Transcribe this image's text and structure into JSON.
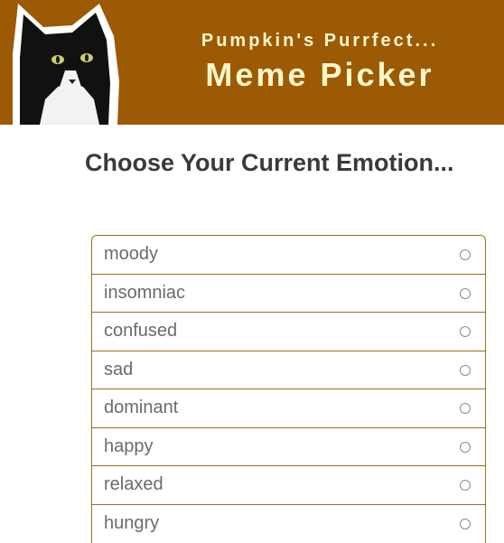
{
  "banner": {
    "subtitle": "Pumpkin's Purrfect...",
    "title": "Meme Picker",
    "background_color": "#9c5a05",
    "text_color": "#fff6c8",
    "logo_icon": "black-and-white-cat-photo"
  },
  "heading": "Choose Your Current Emotion...",
  "emotions": [
    {
      "label": "moody",
      "selected": false
    },
    {
      "label": "insomniac",
      "selected": false
    },
    {
      "label": "confused",
      "selected": false
    },
    {
      "label": "sad",
      "selected": false
    },
    {
      "label": "dominant",
      "selected": false
    },
    {
      "label": "happy",
      "selected": false
    },
    {
      "label": "relaxed",
      "selected": false
    },
    {
      "label": "hungry",
      "selected": false
    }
  ],
  "colors": {
    "border": "#a06a1e",
    "label": "#6b6b6b"
  }
}
